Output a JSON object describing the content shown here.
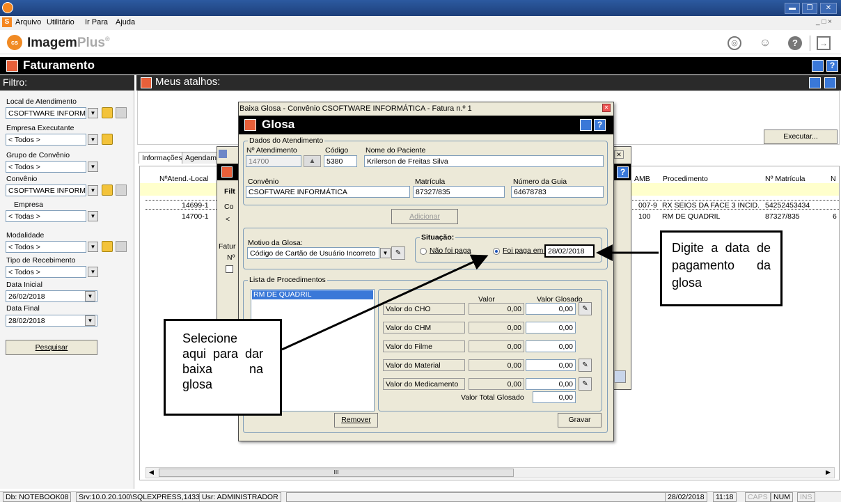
{
  "menu": {
    "items": [
      "Arquivo",
      "Utilitário",
      "Ir Para",
      "Ajuda"
    ]
  },
  "app": {
    "name_part1": "Imagem",
    "name_part2": "Plus",
    "reg": "®"
  },
  "module": {
    "title": "Faturamento"
  },
  "filter": {
    "title": "Filtro:",
    "local_label": "Local de Atendimento",
    "local_value": "CSOFTWARE INFORM/",
    "empresa_exec_label": "Empresa Executante",
    "empresa_exec_value": "< Todos >",
    "grupo_label": "Grupo de Convênio",
    "grupo_value": "< Todos >",
    "convenio_label": "Convênio",
    "convenio_value": "CSOFTWARE INFORM/",
    "empresa_label": "Empresa",
    "empresa_value": "< Todas >",
    "modalidade_label": "Modalidade",
    "modalidade_value": "< Todos >",
    "tipo_label": "Tipo de Recebimento",
    "tipo_value": "< Todos >",
    "data_ini_label": "Data Inicial",
    "data_ini_value": "26/02/2018",
    "data_fim_label": "Data Final",
    "data_fim_value": "28/02/2018",
    "pesquisar": "Pesquisar"
  },
  "atalhos": {
    "title": "Meus atalhos:",
    "executar": "Executar..."
  },
  "tabs": [
    "Informações",
    "Agendam"
  ],
  "grid": {
    "col_atend": "NºAtend.-Local",
    "col_amb": "AMB",
    "col_proc": "Procedimento",
    "col_matric": "Nº Matrícula",
    "col_n": "N",
    "rows": [
      {
        "atend": "14699-1",
        "amb": "007-9",
        "proc": "RX SEIOS DA FACE 3 INCID.",
        "matric": "54252453434"
      },
      {
        "atend": "14700-1",
        "amb": "100",
        "proc": "RM DE QUADRIL",
        "matric": "87327/835",
        "n": "6"
      }
    ]
  },
  "behind": {
    "fil": "Filt",
    "co": "Co",
    "lt": "<",
    "fatur": "Fatur",
    "n": "Nº"
  },
  "dialog": {
    "window_title": "Baixa Glosa - Convênio CSOFTWARE INFORMÁTICA - Fatura n.º 1",
    "header": "Glosa",
    "dados_legend": "Dados do Atendimento",
    "natend_label": "Nº Atendimento",
    "natend_value": "14700",
    "codigo_label": "Código",
    "codigo_value": "5380",
    "nome_label": "Nome do Paciente",
    "nome_value": "Krilerson de Freitas Silva",
    "convenio_label": "Convênio",
    "convenio_value": "CSOFTWARE INFORMÁTICA",
    "matricula_label": "Matrícula",
    "matricula_value": "87327/835",
    "guia_label": "Número da Guia",
    "guia_value": "64678783",
    "adicionar": "Adicionar",
    "motivo_label": "Motivo da Glosa:",
    "motivo_value": "Código de Cartão de Usuário Incorreto",
    "situacao_legend": "Situação:",
    "nao_paga": "Não foi paga",
    "foi_paga": "Foi paga em :",
    "data_pagamento": "28/02/2018",
    "lista_legend": "Lista de Procedimentos",
    "procedimento": "RM DE QUADRIL",
    "valor_header": "Valor",
    "glosado_header": "Valor Glosado",
    "items": [
      {
        "label": "Valor do CHO",
        "valor": "0,00",
        "glosado": "0,00"
      },
      {
        "label": "Valor do CHM",
        "valor": "0,00",
        "glosado": "0,00"
      },
      {
        "label": "Valor do Filme",
        "valor": "0,00",
        "glosado": "0,00"
      },
      {
        "label": "Valor do Material",
        "valor": "0,00",
        "glosado": "0,00"
      },
      {
        "label": "Valor do Medicamento",
        "valor": "0,00",
        "glosado": "0,00"
      }
    ],
    "total_label": "Valor Total Glosado",
    "total_value": "0,00",
    "remover": "Remover",
    "gravar": "Gravar"
  },
  "callouts": {
    "right": "Digite a data de pagamento da glosa",
    "left": "Selecione aqui para dar baixa na glosa"
  },
  "status": {
    "db": "Db: NOTEBOOK08",
    "srv": "Srv:10.0.20.100\\SQLEXPRESS,1433",
    "usr": "Usr: ADMINISTRADOR",
    "date": "28/02/2018",
    "time": "11:18",
    "caps": "CAPS",
    "num": "NUM",
    "ins": "INS"
  },
  "scroll": {
    "thumb": "III"
  }
}
